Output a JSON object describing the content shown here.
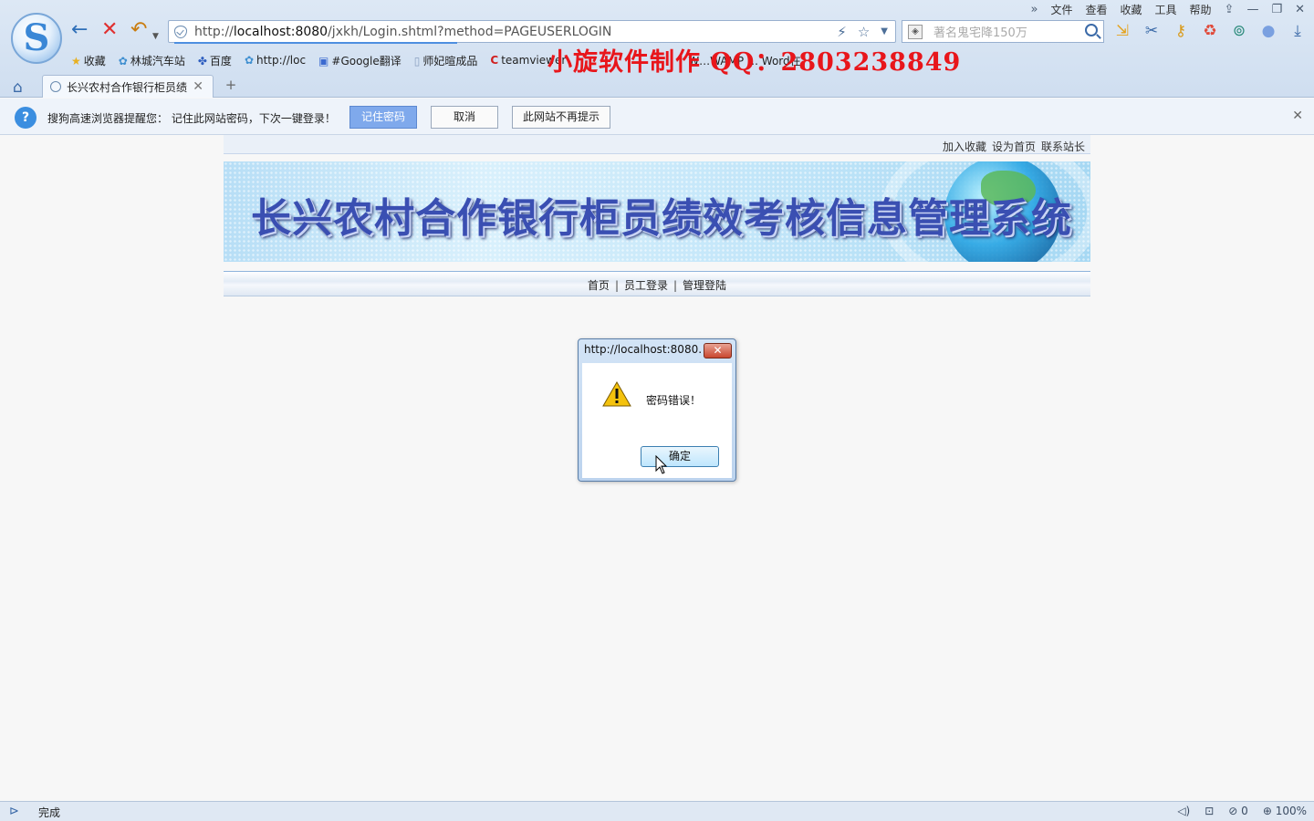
{
  "browser": {
    "menu": [
      "文件",
      "查看",
      "收藏",
      "工具",
      "帮助"
    ],
    "address": {
      "scheme": "http://",
      "host": "localhost:8080",
      "path": "/jxkh/Login.shtml?method=PAGEUSERLOGIN"
    },
    "search_placeholder": "著名鬼宅降150万",
    "bookmarks": [
      {
        "icon": "star-icon",
        "label": "收藏"
      },
      {
        "icon": "site-icon",
        "label": "林城汽车站"
      },
      {
        "icon": "baidu-paw-icon",
        "label": "百度"
      },
      {
        "icon": "site-icon",
        "label": "http://loc"
      },
      {
        "icon": "translate-icon",
        "label": "#Google翻译"
      },
      {
        "icon": "page-icon",
        "label": "师妃暄成品"
      },
      {
        "icon": "red-c-icon",
        "label": "teamviewer"
      }
    ],
    "bookmarks_overflow": "W…WAMP … Word在",
    "watermark": "小旋软件制作  QQ：2803238849",
    "tab_title": "长兴农村合作银行柜员绩",
    "status_text": "完成",
    "status_right": {
      "blocked_count": "0",
      "zoom": "100%"
    }
  },
  "notification": {
    "message": "搜狗高速浏览器提醒您： 记住此网站密码，下次一键登录！",
    "remember_label": "记住密码",
    "cancel_label": "取消",
    "never_label": "此网站不再提示"
  },
  "page": {
    "top_links": [
      "加入收藏",
      "设为首页",
      "联系站长"
    ],
    "banner_title": "长兴农村合作银行柜员绩效考核信息管理系统",
    "nav": [
      "首页",
      "员工登录",
      "管理登陆"
    ]
  },
  "dialog": {
    "title": "http://localhost:8080...",
    "message": "密码错误！",
    "ok_label": "确定",
    "close_glyph": "✕"
  }
}
